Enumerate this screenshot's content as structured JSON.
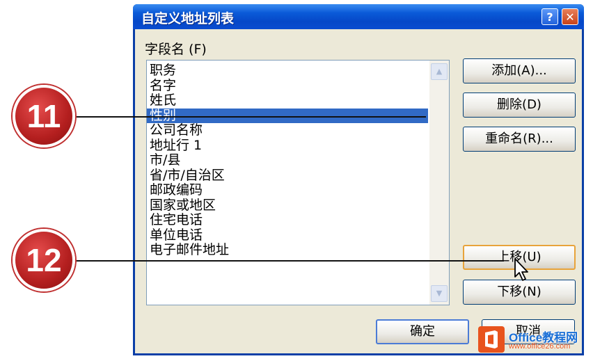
{
  "dialog": {
    "title": "自定义地址列表",
    "help_label": "?",
    "close_label": "✕"
  },
  "field_list": {
    "label": "字段名 (F)",
    "items": [
      {
        "label": "职务",
        "selected": false
      },
      {
        "label": "名字",
        "selected": false
      },
      {
        "label": "姓氏",
        "selected": false
      },
      {
        "label": "性别",
        "selected": true
      },
      {
        "label": "公司名称",
        "selected": false
      },
      {
        "label": "地址行 1",
        "selected": false
      },
      {
        "label": "市/县",
        "selected": false
      },
      {
        "label": "省/市/自治区",
        "selected": false
      },
      {
        "label": "邮政编码",
        "selected": false
      },
      {
        "label": "国家或地区",
        "selected": false
      },
      {
        "label": "住宅电话",
        "selected": false
      },
      {
        "label": "单位电话",
        "selected": false
      },
      {
        "label": "电子邮件地址",
        "selected": false
      }
    ]
  },
  "buttons": {
    "add": "添加(A)...",
    "delete": "删除(D)",
    "rename": "重命名(R)...",
    "move_up": "上移(U)",
    "move_down": "下移(N)",
    "ok": "确定",
    "cancel": "取消"
  },
  "callouts": {
    "step_11": "11",
    "step_12": "12"
  },
  "watermark": {
    "brand": "Office教程网",
    "url": "www.office26.com"
  },
  "colors": {
    "titlebar": "#0a5ad8",
    "selection": "#316ac5",
    "dialog_bg": "#ece9d8",
    "callout": "#c02828",
    "watermark_orange": "#e8531d"
  }
}
